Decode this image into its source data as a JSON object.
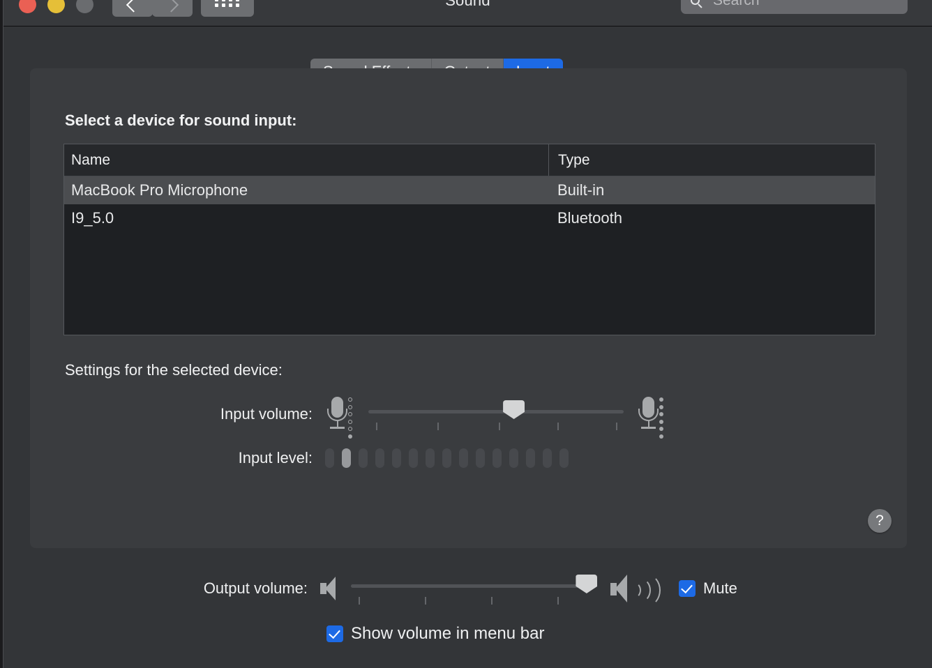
{
  "window": {
    "title": "Sound",
    "traffic_lights": [
      "close",
      "minimize",
      "zoom"
    ],
    "nav": {
      "back": "back-chevron",
      "forward": "forward-chevron",
      "show_all": "grid-icon"
    },
    "search": {
      "placeholder": "Search",
      "value": ""
    }
  },
  "tabs": [
    {
      "label": "Sound Effects",
      "active": false
    },
    {
      "label": "Output",
      "active": false
    },
    {
      "label": "Input",
      "active": true
    }
  ],
  "panel": {
    "select_device_label": "Select a device for sound input:",
    "table": {
      "columns": [
        "Name",
        "Type"
      ],
      "rows": [
        {
          "name": "MacBook Pro Microphone",
          "type": "Built-in",
          "selected": true
        },
        {
          "name": "I9_5.0",
          "type": "Bluetooth",
          "selected": false
        }
      ]
    },
    "settings_label": "Settings for the selected device:",
    "input_volume": {
      "label": "Input volume:",
      "value_percent": 57,
      "ticks": 5,
      "min_icon": "microphone-low-icon",
      "max_icon": "microphone-high-icon"
    },
    "input_level": {
      "label": "Input level:",
      "segments": 15,
      "lit_segments": 2,
      "lit_index": 2
    },
    "help_button": "?"
  },
  "bottom": {
    "output_volume": {
      "label": "Output volume:",
      "value_percent": 96,
      "ticks": 4,
      "min_icon": "speaker-mute-icon",
      "max_icon": "speaker-loud-icon"
    },
    "mute": {
      "label": "Mute",
      "checked": true
    },
    "show_volume_in_menu_bar": {
      "label": "Show volume in menu bar",
      "checked": true
    }
  },
  "colors": {
    "accent": "#1d6ae5",
    "window_bg": "#333538",
    "panel_bg": "#3a3c3f",
    "table_bg": "#1e2023",
    "row_selected": "#4b4d50",
    "traffic_close": "#ea6054",
    "traffic_min": "#e5bf38",
    "traffic_zoom": "#6a6c6f"
  }
}
